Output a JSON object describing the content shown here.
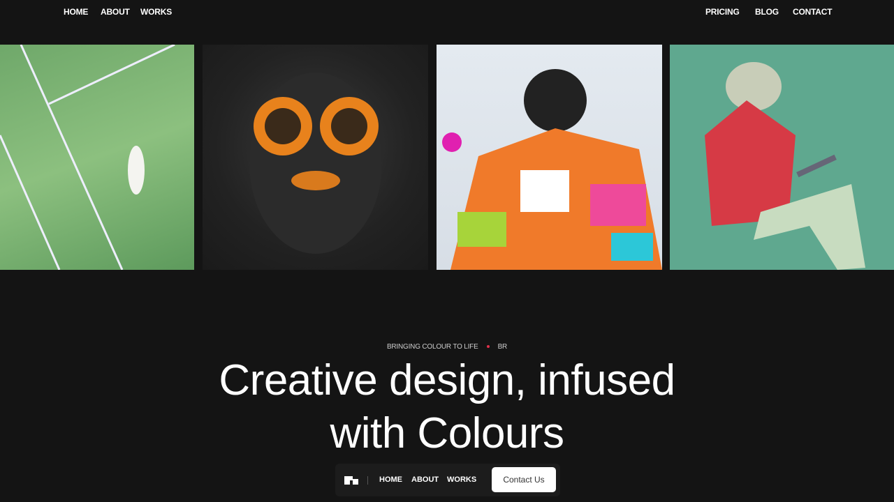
{
  "top_nav": {
    "left": [
      "HOME",
      "ABOUT",
      "WORKS"
    ],
    "right": [
      "PRICING",
      "BLOG",
      "CONTACT"
    ]
  },
  "gallery": [
    {
      "name": "tennis-player-image"
    },
    {
      "name": "orange-glasses-portrait-image"
    },
    {
      "name": "colourful-jacket-image"
    },
    {
      "name": "hoodie-laptop-image"
    }
  ],
  "hero": {
    "tagline": "BRINGING COLOUR TO LIFE",
    "tagline_suffix": "BR",
    "title_line1": "Creative design, infused",
    "title_line2": "with Colours",
    "accent": "#e0304a"
  },
  "dock": {
    "items": [
      "HOME",
      "ABOUT",
      "WORKS"
    ],
    "cta": "Contact Us"
  }
}
